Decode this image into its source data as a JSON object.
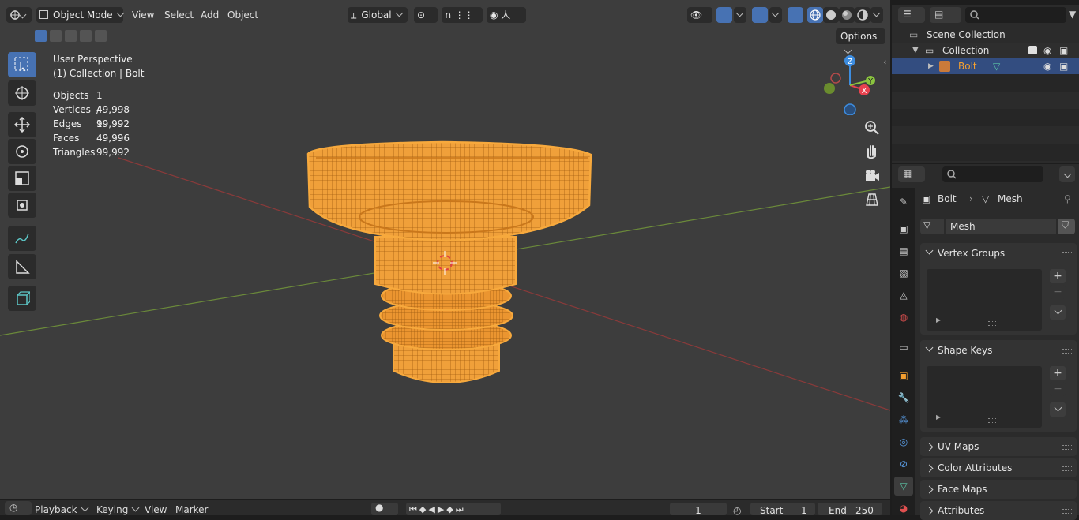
{
  "header": {
    "mode": "Object Mode",
    "menus": [
      "View",
      "Select",
      "Add",
      "Object"
    ],
    "orientation": "Global",
    "options_label": "Options"
  },
  "overlay": {
    "view_name": "User Perspective",
    "context": "(1) Collection | Bolt",
    "stats": [
      {
        "label": "Objects",
        "value": "1 / 1"
      },
      {
        "label": "Vertices",
        "value": "49,998"
      },
      {
        "label": "Edges",
        "value": "99,992"
      },
      {
        "label": "Faces",
        "value": "49,996"
      },
      {
        "label": "Triangles",
        "value": "99,992"
      }
    ]
  },
  "gizmo": {
    "x": "X",
    "y": "Y",
    "z": "Z"
  },
  "outliner": {
    "scene_collection": "Scene Collection",
    "collection": "Collection",
    "object": "Bolt"
  },
  "properties": {
    "breadcrumb_object": "Bolt",
    "breadcrumb_data": "Mesh",
    "mesh_name": "Mesh",
    "panels": [
      {
        "title": "Vertex Groups",
        "expanded": true
      },
      {
        "title": "Shape Keys",
        "expanded": true
      },
      {
        "title": "UV Maps",
        "expanded": false
      },
      {
        "title": "Color Attributes",
        "expanded": false
      },
      {
        "title": "Face Maps",
        "expanded": false
      },
      {
        "title": "Attributes",
        "expanded": false
      }
    ]
  },
  "timeline": {
    "menus": [
      "Playback",
      "Keying",
      "View",
      "Marker"
    ],
    "current_frame": "1",
    "start_label": "Start",
    "start": "1",
    "end_label": "End",
    "end": "250"
  },
  "colors": {
    "selection_orange": "#f5a030",
    "active_blue": "#4772b3",
    "x_axis": "#e8434f",
    "y_axis": "#8ac43f",
    "z_axis": "#3d8de0"
  }
}
